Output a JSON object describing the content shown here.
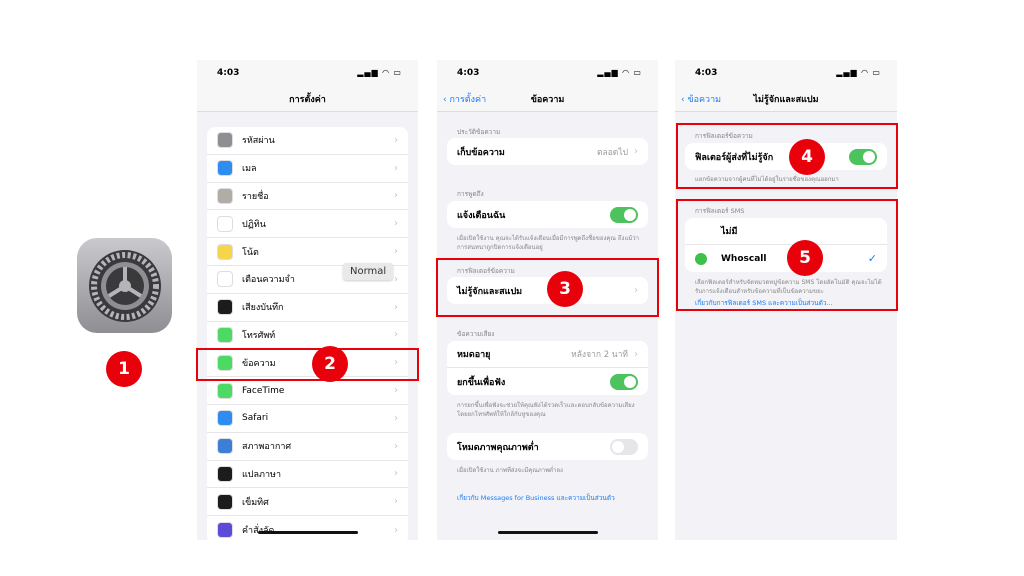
{
  "step_badges": [
    "1",
    "2",
    "3",
    "4",
    "5"
  ],
  "colors": {
    "accent": "#1a7cf5",
    "toggle_on": "#4cc35d",
    "highlight": "#e8000b"
  },
  "status_time": "4:03",
  "tooltip": "Normal",
  "screen1": {
    "title": "การตั้งค่า",
    "items": [
      {
        "label": "รหัสผ่าน",
        "icon": "key-icon",
        "color": "#8e8e93"
      },
      {
        "label": "เมล",
        "icon": "mail-icon",
        "color": "#2f8cf0"
      },
      {
        "label": "รายชื่อ",
        "icon": "contacts-icon",
        "color": "#b0aca6"
      },
      {
        "label": "ปฏิทิน",
        "icon": "calendar-icon",
        "color": "#ffffff"
      },
      {
        "label": "โน้ต",
        "icon": "notes-icon",
        "color": "#f7d54a"
      },
      {
        "label": "เตือนความจำ",
        "icon": "reminders-icon",
        "color": "#ffffff"
      },
      {
        "label": "เสียงบันทึก",
        "icon": "voice-memos-icon",
        "color": "#1c1c1e"
      },
      {
        "label": "โทรศัพท์",
        "icon": "phone-icon",
        "color": "#4cd964"
      },
      {
        "label": "ข้อความ",
        "icon": "messages-icon",
        "color": "#4cd964"
      },
      {
        "label": "FaceTime",
        "icon": "facetime-icon",
        "color": "#4cd964"
      },
      {
        "label": "Safari",
        "icon": "safari-icon",
        "color": "#2f8cf0"
      },
      {
        "label": "สภาพอากาศ",
        "icon": "weather-icon",
        "color": "#3b7fd9"
      },
      {
        "label": "แปลภาษา",
        "icon": "translate-icon",
        "color": "#1c1c1e"
      },
      {
        "label": "เข็มทิศ",
        "icon": "compass-icon",
        "color": "#1c1c1e"
      },
      {
        "label": "คำสั่งลัด",
        "icon": "shortcuts-icon",
        "color": "#5b4bd6"
      }
    ]
  },
  "screen2": {
    "back": "การตั้งค่า",
    "title": "ข้อความ",
    "history_label": "ประวัติข้อความ",
    "keep_messages": "เก็บข้อความ",
    "keep_value": "ตลอดไป",
    "mentions_label": "การพูดถึง",
    "notify_me": "แจ้งเตือนฉัน",
    "notify_on": true,
    "notify_footer": "เมื่อเปิดใช้งาน คุณจะได้รับแจ้งเตือนเมื่อมีการพูดถึงชื่อของคุณ ถึงแม้ว่าการสนทนาถูกปิดการแจ้งเตือนอยู่",
    "filter_label": "การฟิลเตอร์ข้อความ",
    "unknown_spam": "ไม่รู้จักและสแปม",
    "audio_label": "ข้อความเสียง",
    "expire": "หมดอายุ",
    "expire_value": "หลังจาก 2 นาที",
    "raise_listen": "ยกขึ้นเพื่อฟัง",
    "raise_on": true,
    "audio_footer": "การยกขึ้นเพื่อฟังจะช่วยให้คุณฟังได้รวดเร็วและตอบกลับข้อความเสียงโดยยกโทรศัพท์ให้ใกล้กับหูของคุณ",
    "low_quality": "โหมดภาพคุณภาพต่ำ",
    "low_quality_on": false,
    "low_quality_footer": "เมื่อเปิดใช้งาน ภาพที่ส่งจะมีคุณภาพต่ำลง",
    "business_link": "เกี่ยวกับ Messages for Business และความเป็นส่วนตัว"
  },
  "screen3": {
    "back": "ข้อความ",
    "title": "ไม่รู้จักและสแปม",
    "filter_label": "การฟิลเตอร์ข้อความ",
    "filter_unknown": "ฟิลเตอร์ผู้ส่งที่ไม่รู้จัก",
    "filter_unknown_on": true,
    "filter_footer": "แยกข้อความจากผู้คนที่ไม่ได้อยู่ในรายชื่อของคุณออกมา",
    "sms_label": "การฟิลเตอร์ SMS",
    "option_none": "ไม่มี",
    "option_whoscall": "Whoscall",
    "selected": "Whoscall",
    "sms_footer": "เลือกฟิลเตอร์สำหรับจัดหมวดหมู่ข้อความ SMS โดยอัตโนมัติ คุณจะไม่ได้รับการแจ้งเตือนสำหรับข้อความที่เป็นข้อความขยะ",
    "sms_link": "เกี่ยวกับการฟิลเตอร์ SMS และความเป็นส่วนตัว..."
  }
}
